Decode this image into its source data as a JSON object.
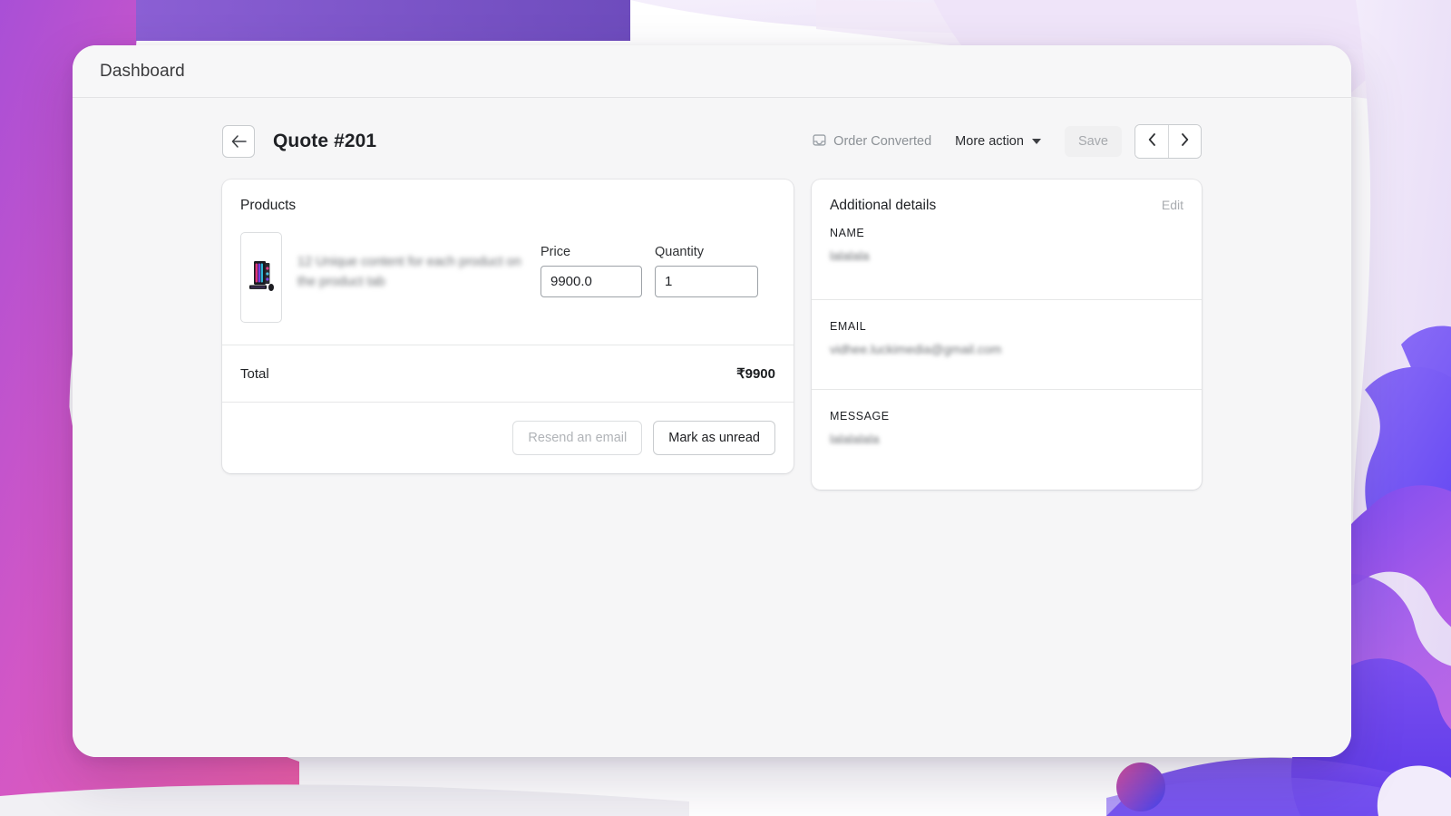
{
  "background": {
    "colors": {
      "left_blob_start": "#d557c4",
      "left_blob_end": "#9b4fd0",
      "top_bar_purple": "#7b52c9",
      "right_violet": "#6c4df0",
      "right_violet_light": "#8f74f5",
      "right_lavender": "#efe6f9",
      "dot_gradient_start": "#e0529f",
      "dot_gradient_end": "#4a4df0",
      "page_white": "#ffffff"
    }
  },
  "window": {
    "surface_color": "#f6f6f7",
    "card_color": "#ffffff"
  },
  "topbar": {
    "title": "Dashboard"
  },
  "page_header": {
    "back_icon": "arrow-left-icon",
    "title": "Quote #201",
    "status": {
      "icon": "inbox-icon",
      "label": "Order Converted"
    },
    "more_action": {
      "label": "More action",
      "icon": "chevron-down-icon"
    },
    "save_label": "Save",
    "pager": {
      "prev_icon": "chevron-left-icon",
      "next_icon": "chevron-right-icon"
    }
  },
  "products": {
    "title": "Products",
    "item": {
      "thumbnail_icon": "gaming-pc-thumbnail",
      "name": "12 Unique content for each product on the product tab",
      "price_label": "Price",
      "price_value": "9900.0",
      "quantity_label": "Quantity",
      "quantity_value": "1"
    },
    "total_label": "Total",
    "total_value": "₹9900",
    "actions": {
      "resend_label": "Resend an email",
      "mark_unread_label": "Mark as unread"
    }
  },
  "additional_details": {
    "title": "Additional details",
    "edit_label": "Edit",
    "fields": [
      {
        "label": "NAME",
        "value": "lalalala"
      },
      {
        "label": "EMAIL",
        "value": "vidhee.luckimedia@gmail.com"
      },
      {
        "label": "MESSAGE",
        "value": "lalalalala"
      }
    ]
  }
}
